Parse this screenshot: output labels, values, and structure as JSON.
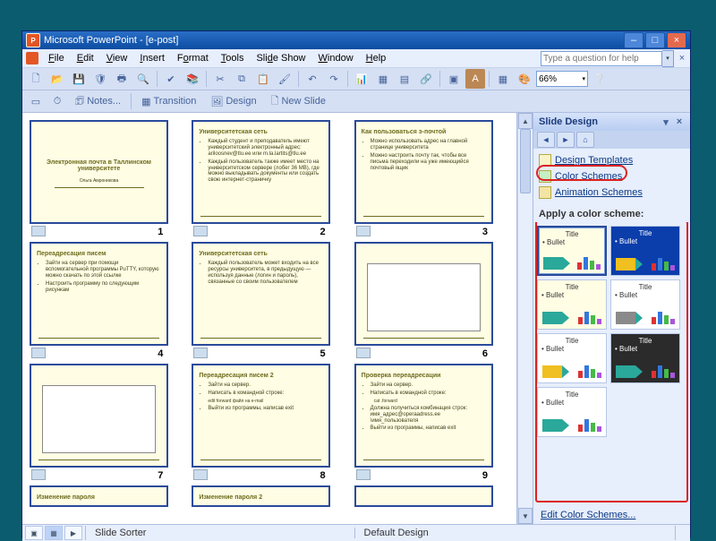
{
  "titlebar": {
    "app": "Microsoft PowerPoint",
    "doc": "[e-post]"
  },
  "menus": {
    "file": "File",
    "edit": "Edit",
    "view": "View",
    "insert": "Insert",
    "format": "Format",
    "tools": "Tools",
    "slideshow": "Slide Show",
    "window": "Window",
    "help": "Help"
  },
  "helpbox": {
    "placeholder": "Type a question for help"
  },
  "toolbar": {
    "zoom": "66%",
    "notes": "Notes...",
    "transition": "Transition",
    "design": "Design",
    "newslide": "New Slide"
  },
  "slides": {
    "s1_title": "Электронная почта в Таллинском университете",
    "s1_sub": "Ольга Амроникова",
    "s2_h": "Университетская сеть",
    "s2_b1": "Каждый студент и преподаватель имеют университетский электронный адрес: ariloosnev@tlu.ee или m.la.lartits@tlu.ee",
    "s2_b2": "Каждый пользователь также имеет место на университетском сервере (лобег 36 MB), где можно выкладывать документы или создать свою интернет-страничку",
    "s3_h": "Как пользоваться э-почтой",
    "s3_b1": "Можно использовать адрес на главной странице университета",
    "s3_b2": "Можно настроить почту так, чтобы все письма переходили на уже имеющийся почтовый ящик",
    "s4_h": "Переадресация писем",
    "s4_b1": "Зайти на сервер при помощи вспомогательной программы PuTTY, которую можно скачать по этой ссылке",
    "s4_b2": "Настроить программу по следующим рисункам",
    "s5_h": "Университетская сеть",
    "s5_b1": "Каждый пользователь может входить на все ресурсы университета, в предыдущую — используя данные (логин и пароль), связанные со своим пользователем",
    "s6_h": "",
    "s7_h": "",
    "s8_h": "Переадресация писем 2",
    "s8_b1": "Зайти на сервер.",
    "s8_b2": "Написать в командной строке:",
    "s8_b3": "edit forward файл на e-mail",
    "s8_b4": "Выйти из программы, написав exit",
    "s9_h": "Проверка переадресации",
    "s9_b1": "Зайти на сервер.",
    "s9_b2": "Написать в командной строке:",
    "s9_b3": "cat .forward",
    "s9_b4": "Должна получиться комбинация строк: имя_адрес@operaadress.ee \\имя_пользователя",
    "s9_b5": "Выйти из программы, написав exit",
    "s10_h": "Изменение пароля",
    "s11_h": "Изменение пароля 2"
  },
  "taskpane": {
    "title": "Slide Design",
    "link_templates": "Design Templates",
    "link_colors": "Color Schemes",
    "link_anim": "Animation Schemes",
    "apply": "Apply a color scheme:",
    "swatch_title": "Title",
    "swatch_bullet": "Bullet",
    "edit": "Edit Color Schemes..."
  },
  "status": {
    "mode": "Slide Sorter",
    "design": "Default Design"
  }
}
